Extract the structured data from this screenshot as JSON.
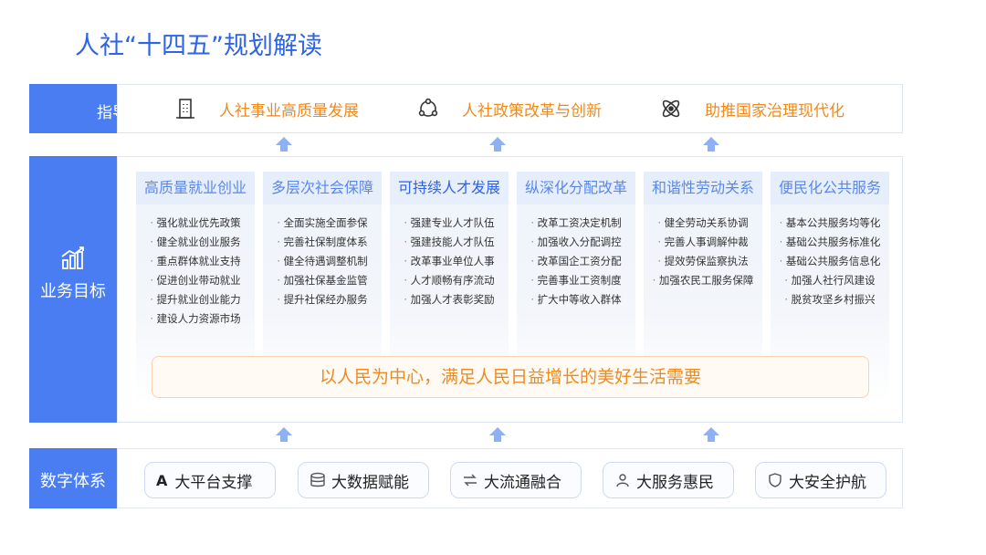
{
  "title": "人社“十四五”规划解读",
  "side_labels": {
    "guide": "指导",
    "business": "业务目标",
    "digital": "数字体系"
  },
  "guide_goals": [
    {
      "icon": "building-icon",
      "label": "人社事业高质量发展"
    },
    {
      "icon": "network-icon",
      "label": "人社政策改革与创新"
    },
    {
      "icon": "atom-icon",
      "label": "助推国家治理现代化"
    }
  ],
  "business_columns": [
    {
      "title": "高质量就业创业",
      "items": [
        "强化就业优先政策",
        "健全就业创业服务",
        "重点群体就业支持",
        "促进创业带动就业",
        "提升就业创业能力",
        "建设人力资源市场"
      ]
    },
    {
      "title": "多层次社会保障",
      "items": [
        "全面实施全面参保",
        "完善社保制度体系",
        "健全待遇调整机制",
        "加强社保基金监管",
        "提升社保经办服务"
      ]
    },
    {
      "title": "可持续人才发展",
      "items": [
        "强建专业人才队伍",
        "强建技能人才队伍",
        "改革事业单位人事",
        "人才顺畅有序流动",
        "加强人才表彰奖励"
      ]
    },
    {
      "title": "纵深化分配改革",
      "items": [
        "改革工资决定机制",
        "加强收入分配调控",
        "改革国企工资分配",
        "完善事业工资制度",
        "扩大中等收入群体"
      ]
    },
    {
      "title": "和谐性劳动关系",
      "items": [
        "健全劳动关系协调",
        "完善人事调解仲裁",
        "提效劳保监察执法",
        "加强农民工服务保障"
      ]
    },
    {
      "title": "便民化公共服务",
      "items": [
        "基本公共服务均等化",
        "基础公共服务标准化",
        "基础公共服务信息化",
        "加强人社行风建设",
        "脱贫攻坚乡村振兴"
      ]
    }
  ],
  "banner": "以人民为中心，满足人民日益增长的美好生活需要",
  "digital_tags": [
    {
      "icon": "A",
      "label": "大平台支撑"
    },
    {
      "icon": "",
      "label": "大数据赋能"
    },
    {
      "icon": "",
      "label": "大流通融合"
    },
    {
      "icon": "",
      "label": "大服务惠民"
    },
    {
      "icon": "",
      "label": "大安全护航"
    }
  ],
  "colors": {
    "primary": "#4a7df2",
    "title": "#2c63e8",
    "accent": "#f08a1c",
    "column_bg": "#eef3fb"
  }
}
